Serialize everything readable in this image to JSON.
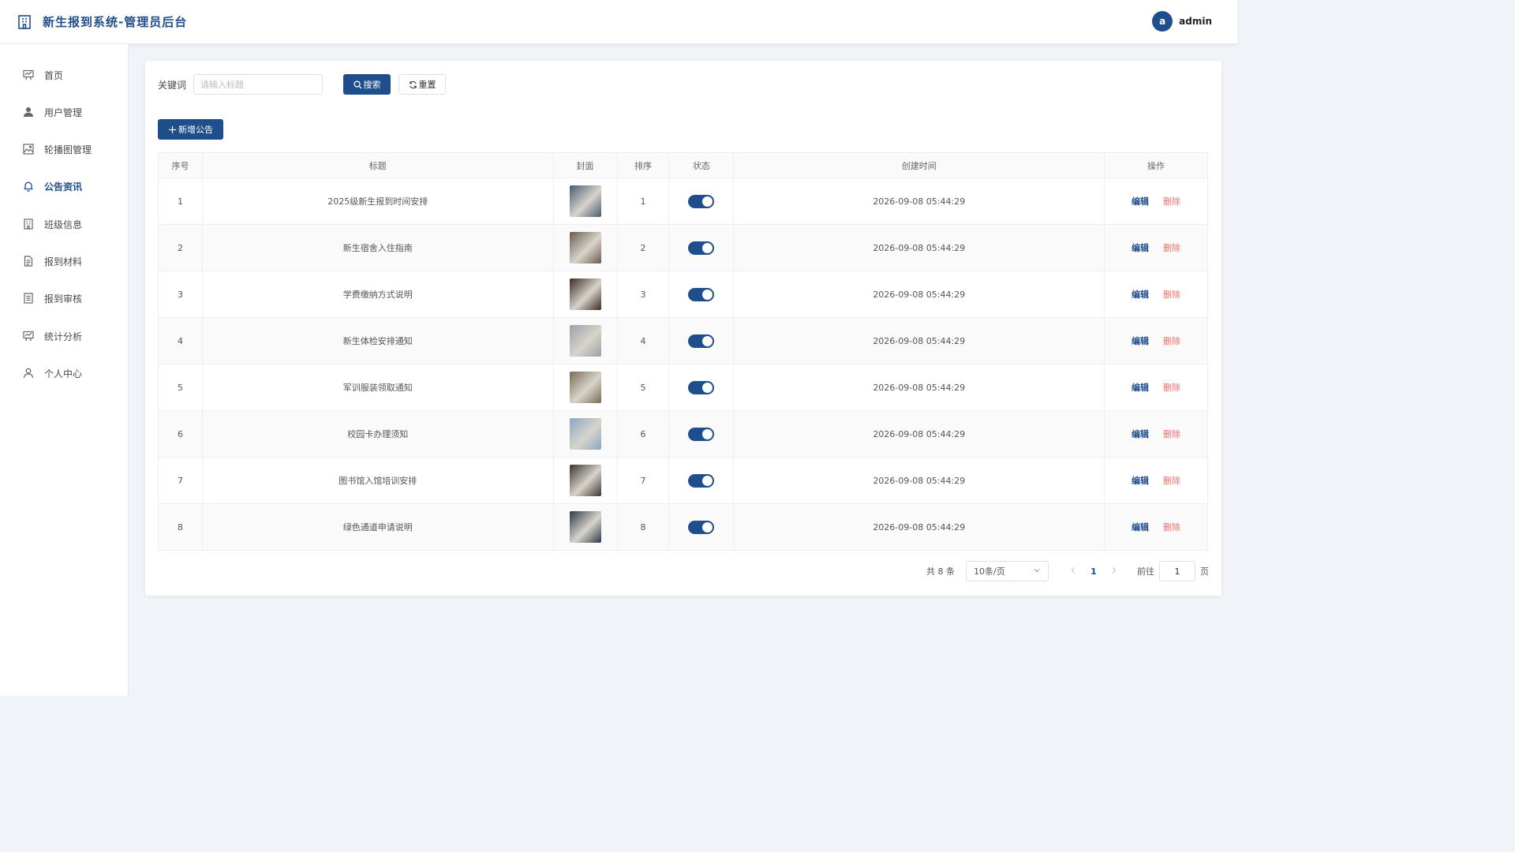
{
  "header": {
    "title": "新生报到系统-管理员后台",
    "avatar_letter": "a",
    "username": "admin",
    "brand_icon": "building-icon"
  },
  "sidebar": {
    "items": [
      {
        "label": "首页",
        "icon": "presentation-icon",
        "active": false
      },
      {
        "label": "用户管理",
        "icon": "user-icon",
        "active": false
      },
      {
        "label": "轮播图管理",
        "icon": "picture-icon",
        "active": false
      },
      {
        "label": "公告资讯",
        "icon": "bell-icon",
        "active": true
      },
      {
        "label": "班级信息",
        "icon": "building-icon",
        "active": false
      },
      {
        "label": "报到材料",
        "icon": "document-icon",
        "active": false
      },
      {
        "label": "报到审核",
        "icon": "tickets-icon",
        "active": false
      },
      {
        "label": "统计分析",
        "icon": "chart-board-icon",
        "active": false
      },
      {
        "label": "个人中心",
        "icon": "user-outline-icon",
        "active": false
      }
    ]
  },
  "search": {
    "label": "关键词",
    "placeholder": "请输入标题",
    "value": "",
    "search_label": "搜索",
    "reset_label": "重置"
  },
  "add_label": "新增公告",
  "table": {
    "headers": [
      "序号",
      "标题",
      "封面",
      "排序",
      "状态",
      "创建时间",
      "操作"
    ],
    "edit_label": "编辑",
    "delete_label": "删除",
    "rows": [
      {
        "index": "1",
        "title": "2025级新生报到时间安排",
        "sort": "1",
        "status": true,
        "created": "2026-09-08 05:44:29",
        "cover_color": "#4a5a6e"
      },
      {
        "index": "2",
        "title": "新生宿舍入住指南",
        "sort": "2",
        "status": true,
        "created": "2026-09-08 05:44:29",
        "cover_color": "#6b5a4e"
      },
      {
        "index": "3",
        "title": "学费缴纳方式说明",
        "sort": "3",
        "status": true,
        "created": "2026-09-08 05:44:29",
        "cover_color": "#3b2a22"
      },
      {
        "index": "4",
        "title": "新生体检安排通知",
        "sort": "4",
        "status": true,
        "created": "2026-09-08 05:44:29",
        "cover_color": "#9aa0a8"
      },
      {
        "index": "5",
        "title": "军训服装领取通知",
        "sort": "5",
        "status": true,
        "created": "2026-09-08 05:44:29",
        "cover_color": "#7a6a52"
      },
      {
        "index": "6",
        "title": "校园卡办理须知",
        "sort": "6",
        "status": true,
        "created": "2026-09-08 05:44:29",
        "cover_color": "#8aa6c4"
      },
      {
        "index": "7",
        "title": "图书馆入馆培训安排",
        "sort": "7",
        "status": true,
        "created": "2026-09-08 05:44:29",
        "cover_color": "#3a3530"
      },
      {
        "index": "8",
        "title": "绿色通道申请说明",
        "sort": "8",
        "status": true,
        "created": "2026-09-08 05:44:29",
        "cover_color": "#2e3a44"
      }
    ]
  },
  "pagination": {
    "total": "共 8 条",
    "page_size": "10条/页",
    "current_page": "1",
    "goto_label": "前往",
    "goto_value": "1",
    "goto_suffix": "页"
  },
  "colors": {
    "primary": "#1f4e8c",
    "danger": "#f56c6c",
    "background": "#f0f3f8"
  }
}
